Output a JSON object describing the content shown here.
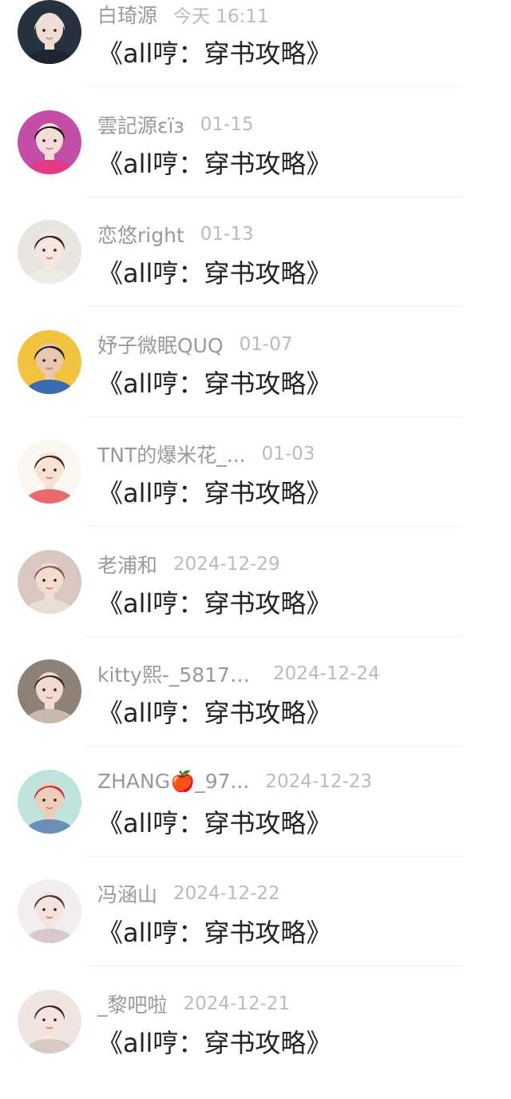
{
  "comments": [
    {
      "user": "白琦源",
      "time": "今天 16:11",
      "text": "《all哼：穿书攻略》",
      "avatar": {
        "bg": "#27323f",
        "skin": "#f1dcd4",
        "hair": "#e8e1e6",
        "shirt": "#1d2630"
      }
    },
    {
      "user": "雲記源εїз",
      "time": "01-15",
      "text": "《all哼：穿书攻略》",
      "avatar": {
        "bg": "#c24ea6",
        "skin": "#f3dcd6",
        "hair": "#1b1416",
        "shirt": "#e23b84"
      }
    },
    {
      "user": "恋悠right",
      "time": "01-13",
      "text": "《all哼：穿书攻略》",
      "avatar": {
        "bg": "#e9e6e2",
        "skin": "#f6e6de",
        "hair": "#2b2223",
        "shirt": "#efece6"
      }
    },
    {
      "user": "妤子微眠QUQ",
      "time": "01-07",
      "text": "《all哼：穿书攻略》",
      "avatar": {
        "bg": "#f2c33e",
        "skin": "#e9c7ae",
        "hair": "#1a1a22",
        "shirt": "#3b6ab2"
      }
    },
    {
      "user": "TNT的爆米花_...",
      "time": "01-03",
      "text": "《all哼：穿书攻略》",
      "avatar": {
        "bg": "#fbf7f2",
        "skin": "#f7e2d4",
        "hair": "#3b2a24",
        "shirt": "#e96a6a"
      }
    },
    {
      "user": "老浦和",
      "time": "2024-12-29",
      "text": "《all哼：穿书攻略》",
      "avatar": {
        "bg": "#d9c7c1",
        "skin": "#f2dccf",
        "hair": "#8a5a50",
        "shirt": "#e9ded8"
      }
    },
    {
      "user": "kitty熙-_58172...",
      "time": "2024-12-24",
      "text": "《all哼：穿书攻略》",
      "avatar": {
        "bg": "#8e8178",
        "skin": "#f1dad0",
        "hair": "#3a2c28",
        "shirt": "#c9b8ae"
      }
    },
    {
      "user": "ZHANG🍎_97...",
      "time": "2024-12-23",
      "text": "《all哼：穿书攻略》",
      "avatar": {
        "bg": "#bfe3dd",
        "skin": "#f0cdb6",
        "hair": "#c62d3c",
        "shirt": "#6c8fb8"
      }
    },
    {
      "user": "冯涵山",
      "time": "2024-12-22",
      "text": "《all哼：穿书攻略》",
      "avatar": {
        "bg": "#f2eef0",
        "skin": "#f4e2dd",
        "hair": "#4a3a3c",
        "shirt": "#d9c9cf"
      }
    },
    {
      "user": "_黎吧啦",
      "time": "2024-12-21",
      "text": "《all哼：穿书攻略》",
      "avatar": {
        "bg": "#efe6e2",
        "skin": "#f5e3dc",
        "hair": "#3a2a28",
        "shirt": "#d8cac5"
      }
    }
  ]
}
